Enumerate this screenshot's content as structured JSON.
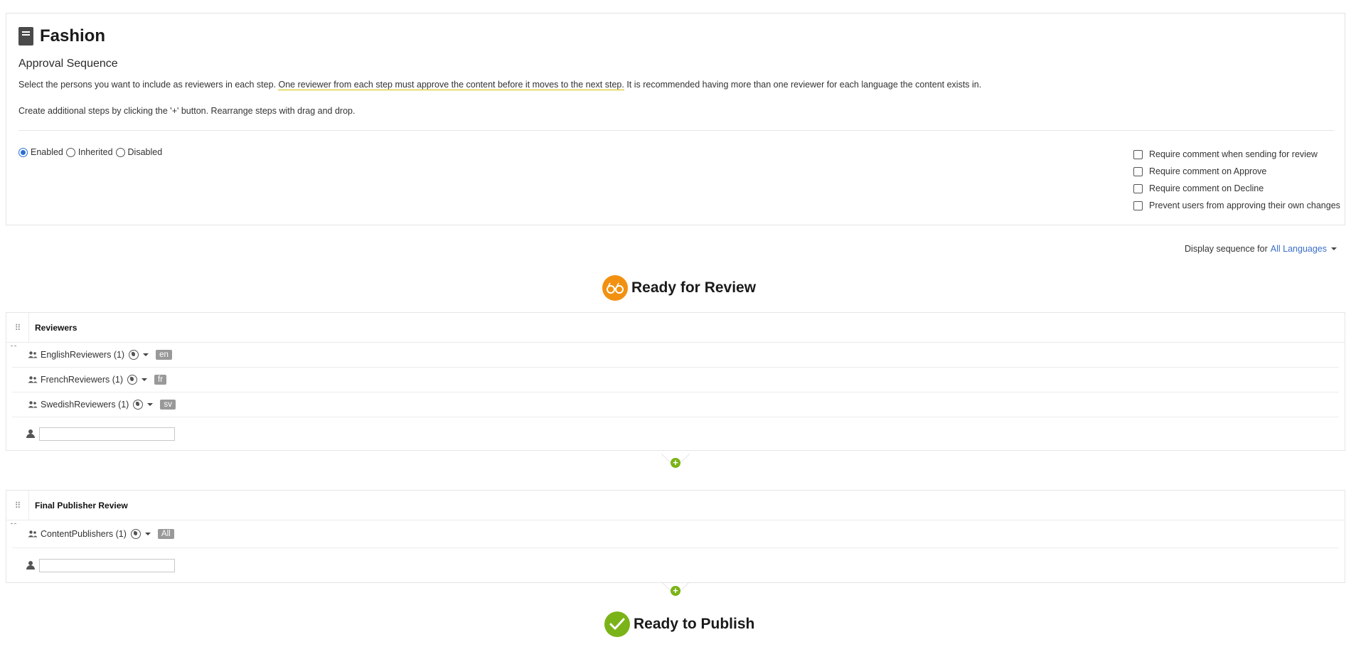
{
  "header": {
    "title": "Fashion",
    "icon": "document-icon"
  },
  "approval": {
    "section_title": "Approval Sequence",
    "description_start": "Select the persons you want to include as reviewers in each step. ",
    "description_underlined": "One reviewer from each step must approve the content before it moves to the next step.",
    "description_end": " It is recommended having more than one reviewer for each language the content exists in.",
    "hint": "Create additional steps by clicking the '+' button. Rearrange steps with drag and drop."
  },
  "mode": {
    "options": [
      "Enabled",
      "Inherited",
      "Disabled"
    ],
    "selected": "Enabled"
  },
  "options": [
    {
      "label": "Require comment when sending for review",
      "checked": false
    },
    {
      "label": "Require comment on Approve",
      "checked": false
    },
    {
      "label": "Require comment on Decline",
      "checked": false
    },
    {
      "label": "Prevent users from approving their own changes",
      "checked": false
    }
  ],
  "display_sequence": {
    "label": "Display sequence for",
    "value": "All Languages"
  },
  "ready_for_review": {
    "label": "Ready for Review",
    "icon": "glasses-icon",
    "color": "#f29111"
  },
  "ready_to_publish": {
    "label": "Ready to Publish",
    "icon": "checkmark-icon",
    "color": "#7ab317"
  },
  "steps": [
    {
      "name": "Reviewers",
      "reviewers": [
        {
          "name": "EnglishReviewers (1)",
          "language": "en"
        },
        {
          "name": "FrenchReviewers (1)",
          "language": "fr"
        },
        {
          "name": "SwedishReviewers (1)",
          "language": "sv"
        }
      ]
    },
    {
      "name": "Final Publisher Review",
      "reviewers": [
        {
          "name": "ContentPublishers (1)",
          "language": "All"
        }
      ]
    }
  ],
  "colors": {
    "accent_green": "#7ab317",
    "accent_orange": "#f29111",
    "link_blue": "#3a6fc9",
    "badge_gray": "#999999"
  }
}
